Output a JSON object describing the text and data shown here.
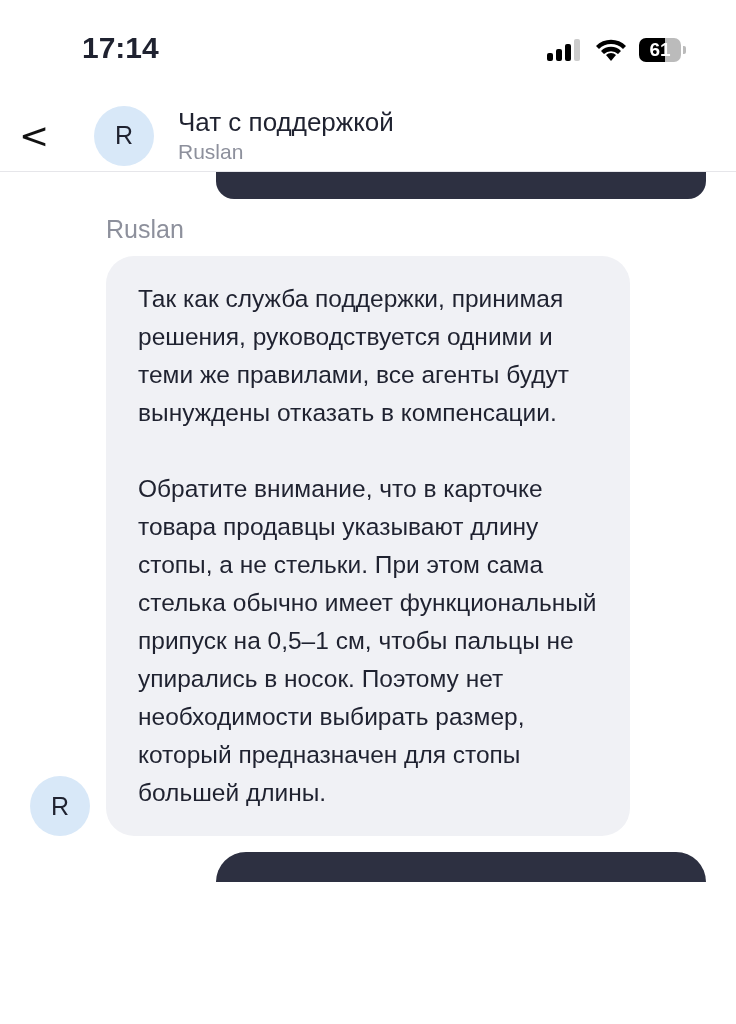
{
  "status_bar": {
    "time": "17:14",
    "battery": "61"
  },
  "header": {
    "back": "<",
    "avatar": "R",
    "title": "Чат с поддержкой",
    "subtitle": "Ruslan"
  },
  "messages": [
    {
      "kind": "outgoing_cut"
    },
    {
      "kind": "incoming",
      "sender": "Ruslan",
      "avatar": "R",
      "paragraphs": [
        "Так как служба поддержки, принимая решения, руководствуется одними и теми же правилами, все агенты будут вынуждены отказать в компенсации.",
        "Обратите внимание, что в карточке товара продавцы указывают длину стопы, а не стельки. При этом сама стелька обычно имеет функциональный припуск на 0,5–1 см, чтобы пальцы не упирались в носок. Поэтому нет необходимости выбирать размер, который предназначен для стопы большей длины."
      ]
    },
    {
      "kind": "outgoing_cut"
    }
  ]
}
